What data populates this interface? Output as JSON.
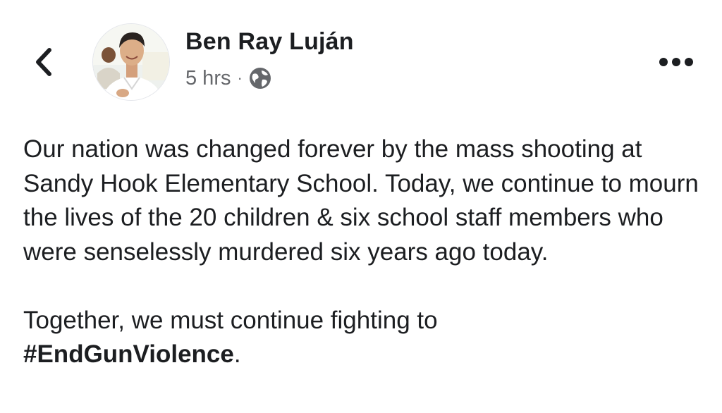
{
  "header": {
    "author_name": "Ben Ray Luján",
    "timestamp": "5 hrs",
    "separator": "·",
    "privacy_icon": "globe-icon",
    "back_icon": "chevron-left-icon",
    "more_icon": "more-options-icon"
  },
  "post": {
    "paragraph1": "Our nation was changed forever by the mass shooting at Sandy Hook Elementary School. Today, we continue to mourn the lives of the 20 children & six school staff members who were senselessly murdered six years ago today.",
    "paragraph2_text": "Together, we must continue fighting to",
    "hashtag": "#EndGunViolence",
    "trailing_punctuation": "."
  },
  "colors": {
    "primary_text": "#1c1e21",
    "secondary_text": "#65676b",
    "background": "#ffffff"
  }
}
